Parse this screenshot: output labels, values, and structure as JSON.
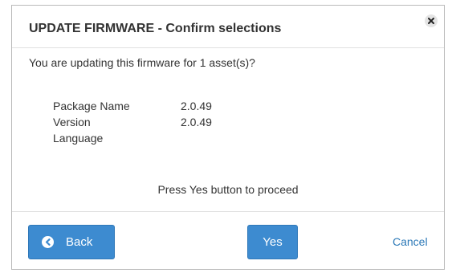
{
  "dialog": {
    "title": "UPDATE FIRMWARE - Confirm selections",
    "message": "You are updating this firmware for 1 asset(s)?",
    "details": [
      {
        "label": "Package Name",
        "value": "2.0.49"
      },
      {
        "label": "Version",
        "value": "2.0.49"
      },
      {
        "label": "Language",
        "value": ""
      }
    ],
    "prompt": "Press Yes button to proceed",
    "buttons": {
      "back_label": "Back",
      "yes_label": "Yes",
      "cancel_label": "Cancel"
    },
    "icons": {
      "close": "close-icon",
      "back": "arrow-left-circle-icon"
    }
  },
  "colors": {
    "accent": "#3d8bd0",
    "link": "#2e7ab8",
    "text": "#333333"
  }
}
